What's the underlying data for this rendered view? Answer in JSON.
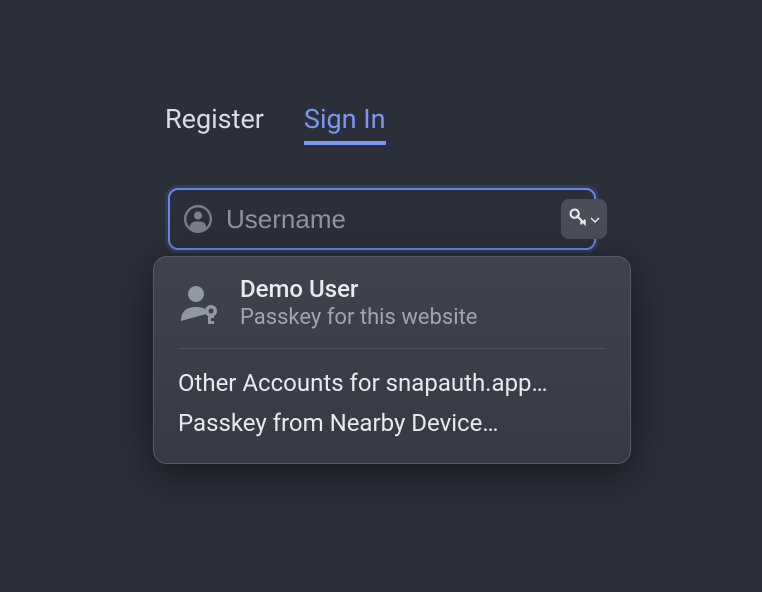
{
  "tabs": {
    "register": "Register",
    "signin": "Sign In"
  },
  "input": {
    "placeholder": "Username",
    "value": ""
  },
  "dropdown": {
    "primary": {
      "title": "Demo User",
      "subtitle": "Passkey for this website"
    },
    "other_accounts": "Other Accounts for snapauth.app…",
    "nearby_device": "Passkey from Nearby Device…"
  }
}
